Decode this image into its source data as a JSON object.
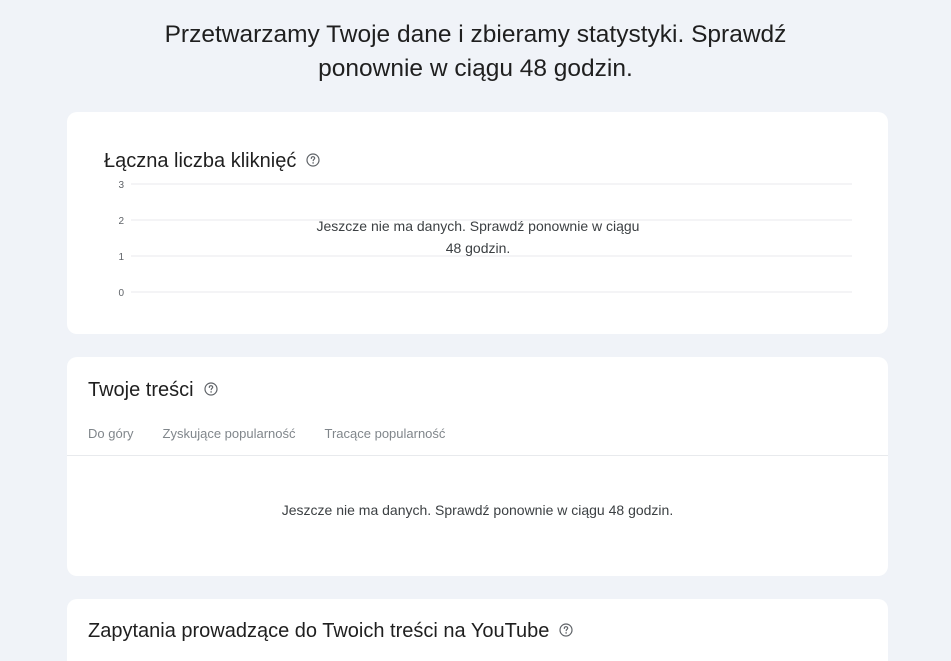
{
  "headline": {
    "line1": "Przetwarzamy Twoje dane i zbieramy statystyki. Sprawdź",
    "line2": "ponownie w ciągu 48 godzin."
  },
  "clicks_card": {
    "title": "Łączna liczba kliknięć",
    "empty_line1": "Jeszcze nie ma danych. Sprawdź ponownie w ciągu",
    "empty_line2": "48 godzin."
  },
  "content_card": {
    "title": "Twoje treści",
    "tabs": [
      "Do góry",
      "Zyskujące popularność",
      "Tracące popularność"
    ],
    "empty_message": "Jeszcze nie ma danych. Sprawdź ponownie w ciągu 48 godzin."
  },
  "queries_card": {
    "title": "Zapytania prowadzące do Twoich treści na YouTube"
  },
  "icons": {
    "help": "help-circle-icon"
  },
  "colors": {
    "page_background": "#f0f3f8",
    "card_background": "#ffffff",
    "gridline": "#e8eaed",
    "muted_text": "#80868b"
  },
  "chart_data": {
    "type": "line",
    "title": "Łączna liczba kliknięć",
    "xlabel": "",
    "ylabel": "",
    "yticks": [
      "0",
      "1",
      "2",
      "3"
    ],
    "ylim": [
      0,
      3
    ],
    "grid": true,
    "series": [],
    "annotation": "Jeszcze nie ma danych. Sprawdź ponownie w ciągu 48 godzin."
  }
}
